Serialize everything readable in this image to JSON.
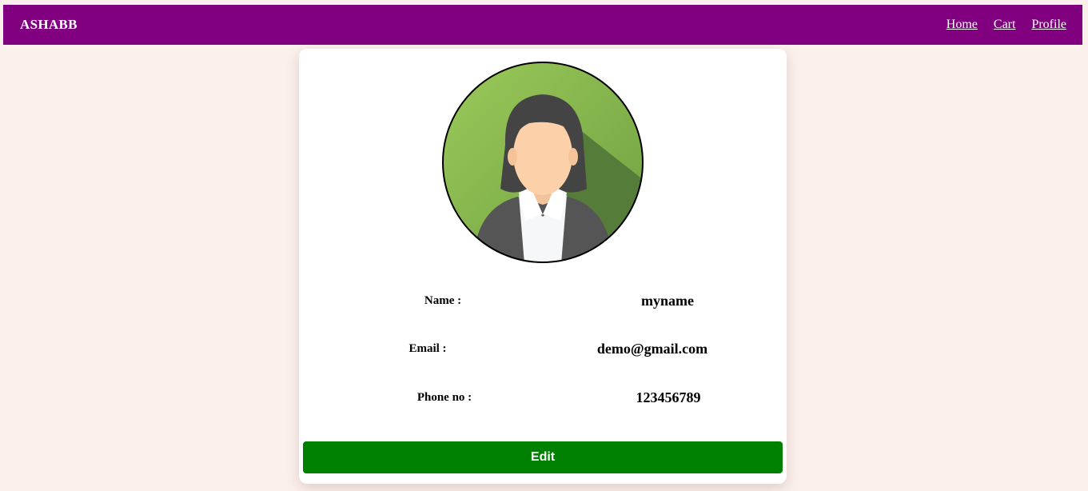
{
  "navbar": {
    "brand": "ASHABB",
    "links": [
      "Home",
      "Cart",
      "Profile"
    ],
    "color": "#800080"
  },
  "profile": {
    "avatar_icon": "female-user-avatar-icon",
    "fields": [
      {
        "label": "Name :",
        "value": "myname"
      },
      {
        "label": "Email :",
        "value": "demo@gmail.com"
      },
      {
        "label": "Phone no :",
        "value": "123456789"
      }
    ],
    "edit_label": "Edit",
    "edit_color": "#008000"
  }
}
